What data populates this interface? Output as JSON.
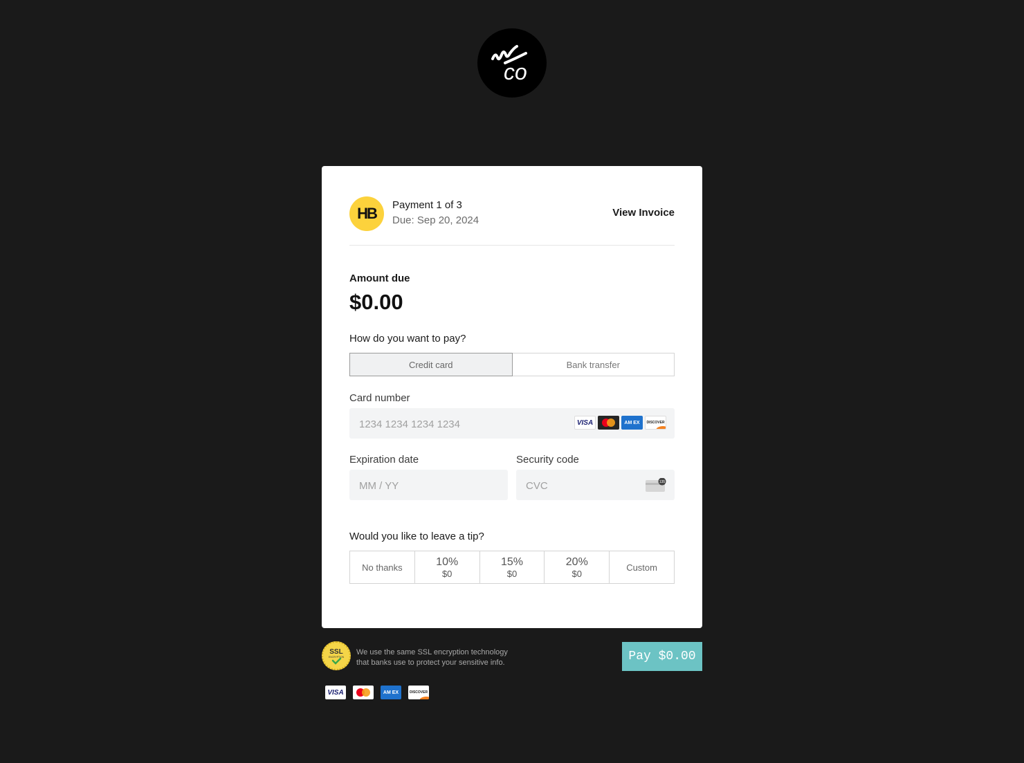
{
  "brand_logo": {
    "name": "mco-logo-icon",
    "text": "mco"
  },
  "header": {
    "avatar_text": "HB",
    "title": "Payment 1 of 3",
    "due": "Due: Sep 20, 2024",
    "view_invoice": "View Invoice"
  },
  "amount": {
    "label": "Amount due",
    "value": "$0.00"
  },
  "payment_method": {
    "question": "How do you want to pay?",
    "options": [
      "Credit card",
      "Bank transfer"
    ],
    "selected": "Credit card"
  },
  "card_number": {
    "label": "Card number",
    "placeholder": "1234 1234 1234 1234"
  },
  "expiration": {
    "label": "Expiration date",
    "placeholder": "MM / YY"
  },
  "security": {
    "label": "Security code",
    "placeholder": "CVC"
  },
  "tip": {
    "question": "Would you like to leave a tip?",
    "no_thanks": "No thanks",
    "options": [
      {
        "pct": "10%",
        "amount": "$0"
      },
      {
        "pct": "15%",
        "amount": "$0"
      },
      {
        "pct": "20%",
        "amount": "$0"
      }
    ],
    "custom": "Custom"
  },
  "ssl": {
    "badge_text": "SSL",
    "badge_subtext": "ENCRYPTION",
    "line1": "We use the same SSL encryption technology",
    "line2": "that banks use to protect your sensitive info."
  },
  "pay_button": "Pay $0.00",
  "card_brands": {
    "visa": "VISA",
    "amex": "AM EX",
    "discover": "DISCOVER",
    "cvc_digits": "135"
  },
  "colors": {
    "page_bg": "#1a1a1a",
    "avatar_bg": "#fcd23c",
    "pay_button_bg": "#6cc3c4"
  }
}
